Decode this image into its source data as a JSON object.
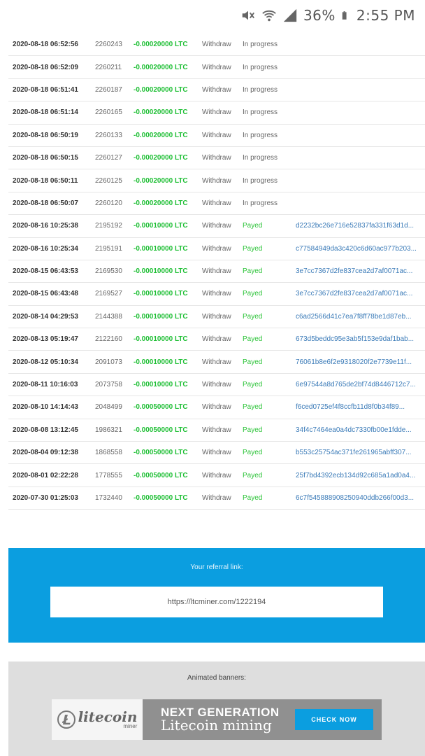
{
  "status_bar": {
    "battery": "36%",
    "time": "2:55 PM",
    "icons": [
      "mute-icon",
      "wifi-icon",
      "signal-icon",
      "battery-icon"
    ]
  },
  "transactions": [
    {
      "date": "2020-08-18 06:52:56",
      "id": "2260243",
      "amount": "-0.00020000 LTC",
      "type": "Withdraw",
      "status": "In progress",
      "hash": ""
    },
    {
      "date": "2020-08-18 06:52:09",
      "id": "2260211",
      "amount": "-0.00020000 LTC",
      "type": "Withdraw",
      "status": "In progress",
      "hash": ""
    },
    {
      "date": "2020-08-18 06:51:41",
      "id": "2260187",
      "amount": "-0.00020000 LTC",
      "type": "Withdraw",
      "status": "In progress",
      "hash": ""
    },
    {
      "date": "2020-08-18 06:51:14",
      "id": "2260165",
      "amount": "-0.00020000 LTC",
      "type": "Withdraw",
      "status": "In progress",
      "hash": ""
    },
    {
      "date": "2020-08-18 06:50:19",
      "id": "2260133",
      "amount": "-0.00020000 LTC",
      "type": "Withdraw",
      "status": "In progress",
      "hash": ""
    },
    {
      "date": "2020-08-18 06:50:15",
      "id": "2260127",
      "amount": "-0.00020000 LTC",
      "type": "Withdraw",
      "status": "In progress",
      "hash": ""
    },
    {
      "date": "2020-08-18 06:50:11",
      "id": "2260125",
      "amount": "-0.00020000 LTC",
      "type": "Withdraw",
      "status": "In progress",
      "hash": ""
    },
    {
      "date": "2020-08-18 06:50:07",
      "id": "2260120",
      "amount": "-0.00020000 LTC",
      "type": "Withdraw",
      "status": "In progress",
      "hash": ""
    },
    {
      "date": "2020-08-16 10:25:38",
      "id": "2195192",
      "amount": "-0.00010000 LTC",
      "type": "Withdraw",
      "status": "Payed",
      "hash": "d2232bc26e716e52837fa331f63d1d..."
    },
    {
      "date": "2020-08-16 10:25:34",
      "id": "2195191",
      "amount": "-0.00010000 LTC",
      "type": "Withdraw",
      "status": "Payed",
      "hash": "c77584949da3c420c6d60ac977b203..."
    },
    {
      "date": "2020-08-15 06:43:53",
      "id": "2169530",
      "amount": "-0.00010000 LTC",
      "type": "Withdraw",
      "status": "Payed",
      "hash": "3e7cc7367d2fe837cea2d7af0071ac..."
    },
    {
      "date": "2020-08-15 06:43:48",
      "id": "2169527",
      "amount": "-0.00010000 LTC",
      "type": "Withdraw",
      "status": "Payed",
      "hash": "3e7cc7367d2fe837cea2d7af0071ac..."
    },
    {
      "date": "2020-08-14 04:29:53",
      "id": "2144388",
      "amount": "-0.00010000 LTC",
      "type": "Withdraw",
      "status": "Payed",
      "hash": "c6ad2566d41c7ea7f8ff78be1d87eb..."
    },
    {
      "date": "2020-08-13 05:19:47",
      "id": "2122160",
      "amount": "-0.00010000 LTC",
      "type": "Withdraw",
      "status": "Payed",
      "hash": "673d5beddc95e3ab5f153e9daf1bab..."
    },
    {
      "date": "2020-08-12 05:10:34",
      "id": "2091073",
      "amount": "-0.00010000 LTC",
      "type": "Withdraw",
      "status": "Payed",
      "hash": "76061b8e6f2e9318020f2e7739e11f..."
    },
    {
      "date": "2020-08-11 10:16:03",
      "id": "2073758",
      "amount": "-0.00010000 LTC",
      "type": "Withdraw",
      "status": "Payed",
      "hash": "6e97544a8d765de2bf74d8446712c7..."
    },
    {
      "date": "2020-08-10 14:14:43",
      "id": "2048499",
      "amount": "-0.00050000 LTC",
      "type": "Withdraw",
      "status": "Payed",
      "hash": "f6ced0725ef4f8ccfb11d8f0b34f89..."
    },
    {
      "date": "2020-08-08 13:12:45",
      "id": "1986321",
      "amount": "-0.00050000 LTC",
      "type": "Withdraw",
      "status": "Payed",
      "hash": "34f4c7464ea0a4dc7330fb00e1fdde..."
    },
    {
      "date": "2020-08-04 09:12:38",
      "id": "1868558",
      "amount": "-0.00050000 LTC",
      "type": "Withdraw",
      "status": "Payed",
      "hash": "b553c25754ac371fe261965abff307..."
    },
    {
      "date": "2020-08-01 02:22:28",
      "id": "1778555",
      "amount": "-0.00050000 LTC",
      "type": "Withdraw",
      "status": "Payed",
      "hash": "25f7bd4392ecb134d92c685a1ad0a4..."
    },
    {
      "date": "2020-07-30 01:25:03",
      "id": "1732440",
      "amount": "-0.00050000 LTC",
      "type": "Withdraw",
      "status": "Payed",
      "hash": "6c7f545888908250940ddb266f00d3..."
    }
  ],
  "referral": {
    "title": "Your referral link:",
    "link": "https://ltcminer.com/1222194"
  },
  "banners": {
    "title": "Animated banners:",
    "logo_main": "litecoin",
    "logo_sub": "miner",
    "headline": "NEXT GENERATION",
    "subheadline": "Litecoin mining",
    "button": "CHECK NOW"
  },
  "colors": {
    "amount": "#1fbf35",
    "hash_link": "#3b7bb8",
    "referral_bg": "#0b9ee0"
  }
}
